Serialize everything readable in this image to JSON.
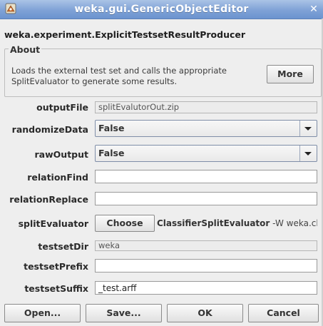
{
  "window": {
    "title": "weka.gui.GenericObjectEditor",
    "close_symbol": "✕",
    "title_bar_color": "#7fa2d6"
  },
  "class_name": "weka.experiment.ExplicitTestsetResultProducer",
  "about": {
    "legend": "About",
    "description": "Loads the external test set and calls the appropriate SplitEvaluator to generate some results.",
    "more_label": "More"
  },
  "properties": {
    "outputFile": {
      "label": "outputFile",
      "value": "splitEvalutorOut.zip"
    },
    "randomizeData": {
      "label": "randomizeData",
      "value": "False"
    },
    "rawOutput": {
      "label": "rawOutput",
      "value": "False"
    },
    "relationFind": {
      "label": "relationFind",
      "value": ""
    },
    "relationReplace": {
      "label": "relationReplace",
      "value": ""
    },
    "splitEvaluator": {
      "label": "splitEvaluator",
      "choose_label": "Choose",
      "class_text": "ClassifierSplitEvaluator",
      "options_text": " -W weka.cla"
    },
    "testsetDir": {
      "label": "testsetDir",
      "value": "weka"
    },
    "testsetPrefix": {
      "label": "testsetPrefix",
      "value": ""
    },
    "testsetSuffix": {
      "label": "testsetSuffix",
      "value": "_test.arff"
    }
  },
  "buttons": {
    "open": "Open...",
    "save": "Save...",
    "ok": "OK",
    "cancel": "Cancel"
  }
}
